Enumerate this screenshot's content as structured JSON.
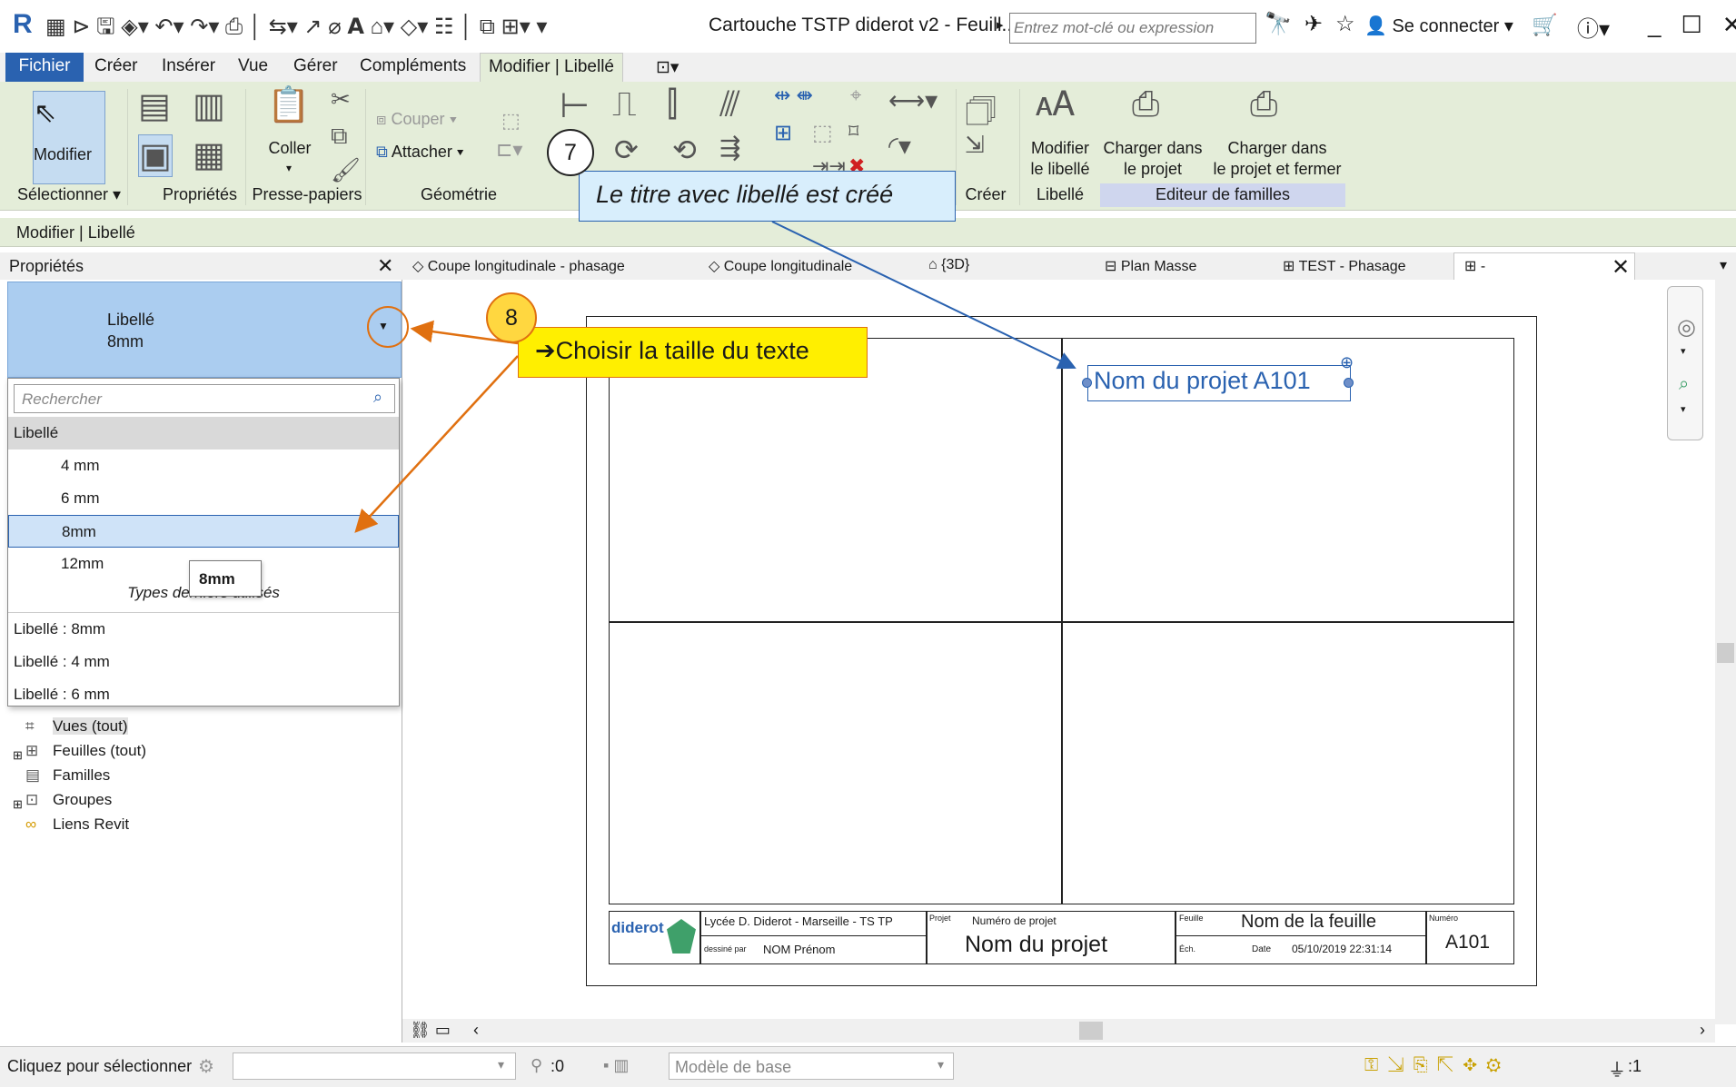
{
  "titlebar": {
    "app_logo": "R",
    "document_title": "Cartouche TSTP diderot v2 - Feuill...",
    "search_placeholder": "Entrez mot-clé ou expression",
    "connect": "Se connecter",
    "icons": [
      "binoculars-icon",
      "satellite-icon",
      "star-icon",
      "user-icon",
      "cart-icon",
      "help-icon"
    ]
  },
  "menu": {
    "items": [
      "Fichier",
      "Créer",
      "Insérer",
      "Vue",
      "Gérer",
      "Compléments",
      "Modifier | Libellé"
    ]
  },
  "ribbon": {
    "modifier": "Modifier",
    "coller": "Coller",
    "couper": "Couper",
    "attacher": "Attacher",
    "modifier_libelle": [
      "Modifier",
      "le libellé"
    ],
    "charger": [
      "Charger dans",
      "le projet"
    ],
    "charger_fermer": [
      "Charger dans",
      "le projet et fermer"
    ],
    "groups": {
      "selectionner": "Sélectionner",
      "proprietes": "Propriétés",
      "presse_papiers": "Presse-papiers",
      "geometrie": "Géométrie",
      "creer": "Créer",
      "libelle": "Libellé",
      "editeur": "Editeur de familles"
    }
  },
  "context_bar": "Modifier | Libellé",
  "properties": {
    "title": "Propriétés",
    "type_family": "Libellé",
    "type_size": "8mm",
    "search_placeholder": "Rechercher",
    "dropdown": {
      "family_header": "Libellé",
      "sizes": [
        "4 mm",
        "6 mm",
        "8mm",
        "12mm"
      ],
      "selected_index": 2,
      "recent_header": "Types derniers utilisés",
      "recent": [
        "Libellé : 8mm",
        "Libellé : 4 mm",
        "Libellé : 6 mm"
      ]
    },
    "tooltip": "8mm"
  },
  "browser": {
    "items": [
      {
        "icon": "views-icon",
        "label": "Vues (tout)",
        "expandable": false,
        "highlight": true
      },
      {
        "icon": "sheets-icon",
        "label": "Feuilles (tout)",
        "expandable": true
      },
      {
        "icon": "families-icon",
        "label": "Familles",
        "expandable": false
      },
      {
        "icon": "groups-icon",
        "label": "Groupes",
        "expandable": true
      },
      {
        "icon": "revit-links-icon",
        "label": "Liens Revit",
        "expandable": false
      }
    ]
  },
  "tabs": [
    "Coupe longitudinale - phasage",
    "Coupe longitudinale",
    "{3D}",
    "Plan Masse",
    "TEST - Phasage",
    "-"
  ],
  "sheet": {
    "label_text": "Nom du projet   A101",
    "school": "Lycée D. Diderot - Marseille - TS TP",
    "drawn_by_label": "dessiné par",
    "drawn_by": "NOM Prénom",
    "projet_small": "Projet",
    "project_number_label": "Numéro de projet",
    "project_name": "Nom du projet",
    "feuille_small": "Feuille",
    "sheet_name": "Nom de la feuille",
    "ech_small": "Éch.",
    "date_label": "Date",
    "date_value": "05/10/2019 22:31:14",
    "numero_small": "Numéro",
    "sheet_number": "A101",
    "logo_text": "diderot"
  },
  "status": {
    "hint": "Cliquez pour sélectionner",
    "zero": ":0",
    "model": "Modèle de base",
    "filter_count": ":1"
  },
  "callouts": {
    "n7": "7",
    "text7": "Le titre avec libellé est créé",
    "n8": "8",
    "text8": "➔Choisir la taille du texte"
  },
  "colors": {
    "brand_blue": "#2a62b0",
    "ribbon_green": "#e4edd9",
    "selection_blue": "#abcdf0",
    "callout_yellow": "#ffef00",
    "callout_orange": "#e07010",
    "callout_blue": "#d8eefc"
  }
}
